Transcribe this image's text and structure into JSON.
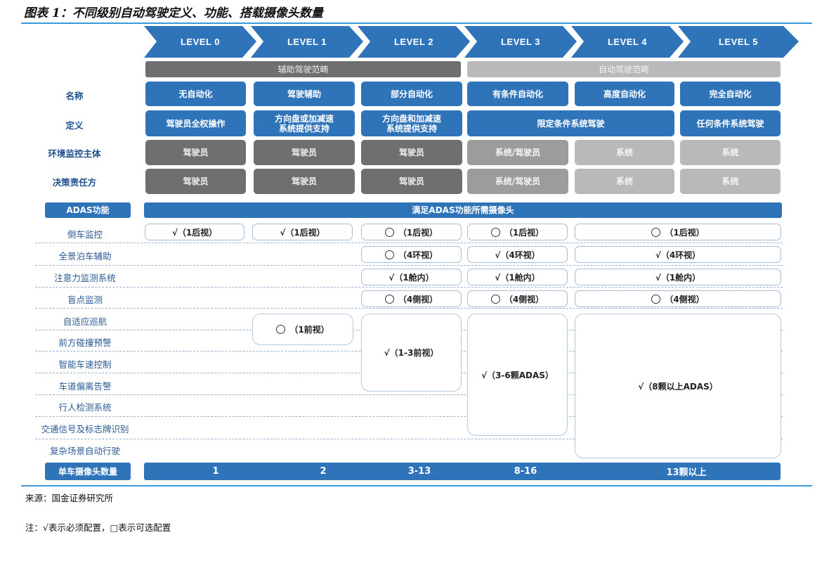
{
  "title": "图表 1：不同级别自动驾驶定义、功能、搭载摄像头数量",
  "levels": [
    "LEVEL 0",
    "LEVEL 1",
    "LEVEL 2",
    "LEVEL 3",
    "LEVEL 4",
    "LEVEL 5"
  ],
  "scope": {
    "assist": "辅助驾驶范畴",
    "auto": "自动驾驶范畴"
  },
  "rows": {
    "name_label": "名称",
    "names": [
      "无自动化",
      "驾驶辅助",
      "部分自动化",
      "有条件自动化",
      "高度自动化",
      "完全自动化"
    ],
    "def_label": "定义",
    "defs": [
      "驾驶员全权操作",
      "方向盘或加减速\n系统提供支持",
      "方向盘和加减速\n系统提供支持",
      "限定条件系统驾驶",
      "任何条件系统驾驶"
    ],
    "env_label": "环境监控主体",
    "env": [
      "驾驶员",
      "驾驶员",
      "驾驶员",
      "系统/驾驶员",
      "系统",
      "系统"
    ],
    "dec_label": "决策责任方",
    "dec": [
      "驾驶员",
      "驾驶员",
      "驾驶员",
      "系统/驾驶员",
      "系统",
      "系统"
    ]
  },
  "adas": {
    "label": "ADAS功能",
    "banner": "满足ADAS功能所需摄像头"
  },
  "features": [
    "倒车监控",
    "全景泊车辅助",
    "注意力监测系统",
    "盲点监测",
    "自适应巡航",
    "前方碰撞预警",
    "智能车速控制",
    "车道偏离告警",
    "行人检测系统",
    "交通信号及标志牌识别",
    "复杂场景自动行驶"
  ],
  "cells": {
    "rear_l0": "√（1后视）",
    "rear_l1": "√（1后视）",
    "rear_l2": "（1后视）",
    "rear_l3": "（1后视）",
    "rear_l45": "（1后视）",
    "pano_l2": "（4环视）",
    "pano_l3": "√（4环视）",
    "pano_l45": "√（4环视）",
    "att_l2": "√（1舱内）",
    "att_l3": "√（1舱内）",
    "att_l45": "√（1舱内）",
    "blind_l2": "（4侧视）",
    "blind_l3": "（4侧视）",
    "blind_l45": "（4侧视）",
    "acc_l1": "（1前视）",
    "adas_l2": "√（1-3前视）",
    "adas_l3": "√（3-6颗ADAS）",
    "adas_l45": "√（8颗以上ADAS）"
  },
  "camera": {
    "label": "单车摄像头数量",
    "counts": [
      "1",
      "2",
      "3-13",
      "8-16",
      "13颗以上"
    ]
  },
  "source": "来源：国金证券研究所",
  "note": "注：√表示必须配置，□表示可选配置",
  "colors": {
    "blue": "#2f74b9",
    "dark_gray": "#6f6f6f",
    "light_gray": "#b9b9b9",
    "rule": "#3a9ad9"
  }
}
